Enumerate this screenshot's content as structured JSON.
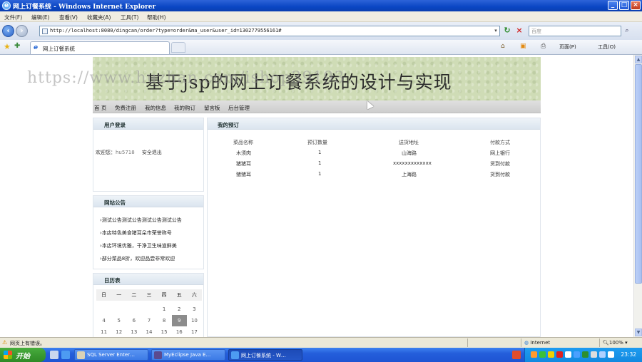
{
  "window": {
    "title": "网上订餐系统 - Windows Internet Explorer"
  },
  "menu": [
    "文件(F)",
    "编辑(E)",
    "查看(V)",
    "收藏夹(A)",
    "工具(T)",
    "帮助(H)"
  ],
  "address": {
    "url": "http://localhost:8080/dingcan/order?type=order&ma_user&user_id=1302779556161#",
    "search_placeholder": "百度"
  },
  "tab": {
    "label": "网上订餐系统"
  },
  "commands": {
    "page": "页面(P)",
    "tools": "工具(O)"
  },
  "page": {
    "banner_title": "基于jsp的网上订餐系统的设计与实现",
    "watermark": "https://www.huzhan.com/ishop39193",
    "nav": [
      "首 页",
      "免费注册",
      "我的信息",
      "我的购订",
      "留言板",
      "后台管理"
    ],
    "login": {
      "title": "用户登录",
      "welcome": "欢迎您：",
      "username": "hu5718",
      "logout": "安全退出"
    },
    "notice": {
      "title": "网站公告",
      "items": [
        "›测试公告测试公告测试公告测试公告",
        "›本店特色美食猪耳朵市荣誉称号",
        "›本店环境优雅，干净卫生味道鲜美",
        "›部分菜品8折，欢迎品尝非常欢迎"
      ]
    },
    "calendar": {
      "title": "日历表",
      "weekdays": [
        "日",
        "一",
        "二",
        "三",
        "四",
        "五",
        "六"
      ],
      "rows": [
        [
          "",
          "",
          "",
          "",
          "1",
          "2",
          "3"
        ],
        [
          "4",
          "5",
          "6",
          "7",
          "8",
          "9",
          "10"
        ],
        [
          "11",
          "12",
          "13",
          "14",
          "15",
          "16",
          "17"
        ]
      ],
      "today": "9"
    },
    "orders": {
      "title": "我的预订",
      "headers": [
        "菜品名称",
        "预订数量",
        "送货地址",
        "付款方式"
      ],
      "rows": [
        [
          "木须肉",
          "1",
          "山海路",
          "网上银行"
        ],
        [
          "猪猪耳",
          "1",
          "xxxxxxxxxxxxx",
          "货到付款"
        ],
        [
          "猪猪耳",
          "1",
          "上海路",
          "货到付款"
        ]
      ]
    }
  },
  "status": {
    "text": "网页上有错误。",
    "zone": "Internet",
    "zoom": "100%"
  },
  "taskbar": {
    "start": "开始",
    "buttons": [
      "SQL Server Enter…",
      "MyEclipse Java E…",
      "网上订餐系统 - W…"
    ],
    "clock": "23:32"
  }
}
